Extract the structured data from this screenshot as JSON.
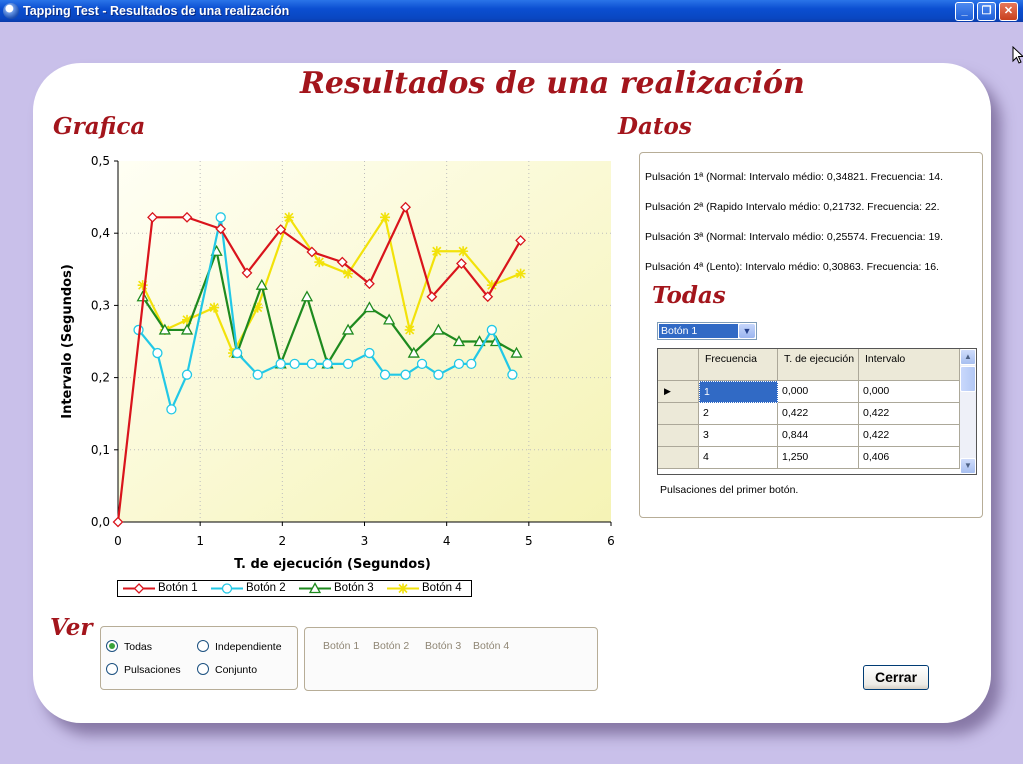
{
  "window": {
    "title": "Tapping Test - Resultados de una realización",
    "btn_min": "_",
    "btn_max": "❐",
    "btn_close": "✕"
  },
  "headings": {
    "main": "Resultados de una realización",
    "grafica": "Grafica",
    "datos": "Datos",
    "todas": "Todas",
    "ver": "Ver"
  },
  "chart_data": {
    "type": "line",
    "xlabel": "T. de ejecución (Segundos)",
    "ylabel": "Intervalo (Segundos)",
    "xlim": [
      0,
      6
    ],
    "ylim": [
      0,
      0.5
    ],
    "xticks": [
      "0",
      "1",
      "2",
      "3",
      "4",
      "5",
      "6"
    ],
    "yticks": [
      "0,0",
      "0,1",
      "0,2",
      "0,3",
      "0,4",
      "0,5"
    ],
    "grid": true,
    "legend": "bottom",
    "series": [
      {
        "name": "Botón 1",
        "color": "#d9141c",
        "marker": "diamond",
        "x": [
          0,
          0.42,
          0.84,
          1.25,
          1.57,
          1.98,
          2.36,
          2.73,
          3.06,
          3.5,
          3.82,
          4.18,
          4.5,
          4.9
        ],
        "y": [
          0,
          0.422,
          0.422,
          0.406,
          0.345,
          0.405,
          0.374,
          0.36,
          0.33,
          0.436,
          0.312,
          0.358,
          0.312,
          0.39
        ]
      },
      {
        "name": "Botón 2",
        "color": "#22c8e6",
        "marker": "circle",
        "x": [
          0.25,
          0.48,
          0.65,
          0.84,
          1.25,
          1.45,
          1.7,
          1.98,
          2.15,
          2.36,
          2.55,
          2.8,
          3.06,
          3.25,
          3.5,
          3.7,
          3.9,
          4.15,
          4.3,
          4.55,
          4.8
        ],
        "y": [
          0.266,
          0.234,
          0.156,
          0.204,
          0.422,
          0.234,
          0.204,
          0.219,
          0.219,
          0.219,
          0.219,
          0.219,
          0.234,
          0.204,
          0.204,
          0.219,
          0.204,
          0.219,
          0.219,
          0.266,
          0.204
        ]
      },
      {
        "name": "Botón 3",
        "color": "#1e8a1e",
        "marker": "triangle",
        "x": [
          0.3,
          0.57,
          0.84,
          1.2,
          1.45,
          1.75,
          1.98,
          2.3,
          2.55,
          2.8,
          3.06,
          3.3,
          3.6,
          3.9,
          4.15,
          4.4,
          4.6,
          4.85
        ],
        "y": [
          0.312,
          0.266,
          0.266,
          0.375,
          0.234,
          0.328,
          0.219,
          0.312,
          0.219,
          0.266,
          0.297,
          0.28,
          0.234,
          0.266,
          0.25,
          0.25,
          0.25,
          0.234
        ]
      },
      {
        "name": "Botón 4",
        "color": "#f2e20a",
        "marker": "star",
        "x": [
          0.3,
          0.57,
          0.84,
          1.17,
          1.4,
          1.7,
          2.08,
          2.45,
          2.8,
          3.25,
          3.55,
          3.88,
          4.2,
          4.55,
          4.9
        ],
        "y": [
          0.328,
          0.266,
          0.28,
          0.297,
          0.234,
          0.297,
          0.422,
          0.36,
          0.344,
          0.422,
          0.266,
          0.375,
          0.375,
          0.328,
          0.344
        ]
      }
    ]
  },
  "datos": {
    "lines": [
      "Pulsación 1ª (Normal: Intervalo médio: 0,34821. Frecuencia: 14.",
      "Pulsación 2ª (Rapido Intervalo médio: 0,21732. Frecuencia: 22.",
      "Pulsación 3ª (Normal: Intervalo médio: 0,25574. Frecuencia: 19.",
      "Pulsación 4ª (Lento):  Intervalo médio: 0,30863. Frecuencia: 16."
    ]
  },
  "combo": {
    "selected": "Botón 1",
    "arrow": "▼"
  },
  "table": {
    "headers": [
      "Frecuencia",
      "T. de ejecución",
      "Intervalo"
    ],
    "row_marker": "▶",
    "rows": [
      [
        "1",
        "0,000",
        "0,000"
      ],
      [
        "2",
        "0,422",
        "0,422"
      ],
      [
        "3",
        "0,844",
        "0,422"
      ],
      [
        "4",
        "1,250",
        "0,406"
      ]
    ],
    "caption": "Pulsaciones del primer botón."
  },
  "ver": {
    "options": [
      "Todas",
      "Independiente",
      "Pulsaciones",
      "Conjunto"
    ],
    "selected": "Todas"
  },
  "button_filters": [
    "Botón 1",
    "Botón 2",
    "Botón 3",
    "Botón 4"
  ],
  "cerrar_label": "Cerrar"
}
